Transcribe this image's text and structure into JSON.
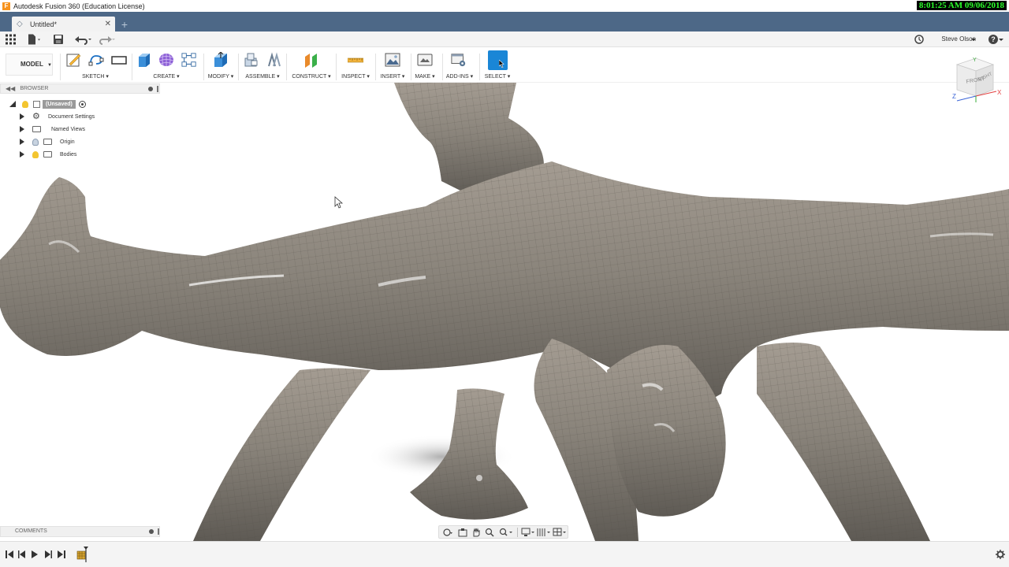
{
  "window": {
    "title": "Autodesk Fusion 360 (Education License)",
    "clock": "8:01:25 AM 09/06/2018"
  },
  "tabs": {
    "active_doc": "Untitled*",
    "new_tab": "+"
  },
  "qat": {
    "user": "Steve Olson",
    "help": "?"
  },
  "workspace": "MODEL",
  "toolbar": {
    "groups": [
      {
        "id": "sketch",
        "label": "SKETCH"
      },
      {
        "id": "create",
        "label": "CREATE"
      },
      {
        "id": "modify",
        "label": "MODIFY"
      },
      {
        "id": "assemble",
        "label": "ASSEMBLE"
      },
      {
        "id": "construct",
        "label": "CONSTRUCT"
      },
      {
        "id": "inspect",
        "label": "INSPECT"
      },
      {
        "id": "insert",
        "label": "INSERT"
      },
      {
        "id": "make",
        "label": "MAKE"
      },
      {
        "id": "addins",
        "label": "ADD-INS"
      },
      {
        "id": "select",
        "label": "SELECT"
      }
    ]
  },
  "browser": {
    "title": "BROWSER",
    "root": "(Unsaved)",
    "items": [
      "Document Settings",
      "Named Views",
      "Origin",
      "Bodies"
    ]
  },
  "comments": {
    "title": "COMMENTS"
  },
  "viewcube": {
    "front": "FRONT",
    "right": "RIGHT",
    "x": "X",
    "y": "Y",
    "z": "Z"
  },
  "colors": {
    "accent": "#1a86d6",
    "tabbar": "#4d6887",
    "model": "#8a847b"
  }
}
